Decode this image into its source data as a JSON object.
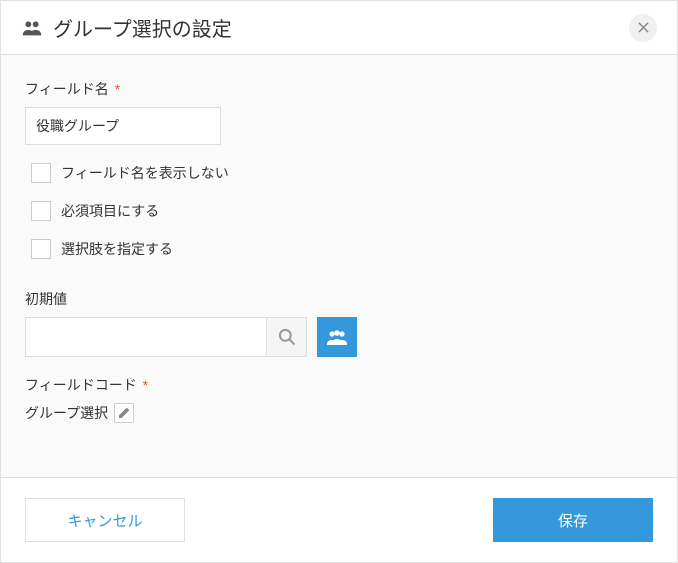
{
  "header": {
    "title": "グループ選択の設定"
  },
  "form": {
    "fieldNameLabel": "フィールド名",
    "fieldNameValue": "役職グループ",
    "hideFieldNameLabel": "フィールド名を表示しない",
    "requiredLabel": "必須項目にする",
    "specifyOptionsLabel": "選択肢を指定する",
    "defaultValueLabel": "初期値",
    "defaultSearchValue": "",
    "fieldCodeLabel": "フィールドコード",
    "fieldCodeValue": "グループ選択"
  },
  "footer": {
    "cancelLabel": "キャンセル",
    "saveLabel": "保存"
  }
}
